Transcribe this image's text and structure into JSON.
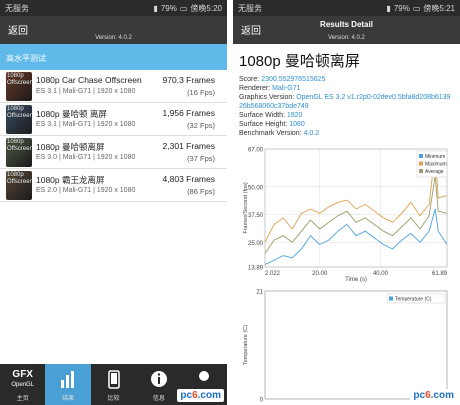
{
  "left": {
    "status": {
      "carrier": "无服务",
      "battery": "79%",
      "time": "傍晚5:20"
    },
    "appbar": {
      "back": "返回",
      "version": "Version: 4.0.2"
    },
    "section": "高水平测试",
    "tests": [
      {
        "thumb": "1080p Offscreen",
        "name": "1080p Car Chase Offscreen",
        "sub": "ES 3.1 | Mali-G71 | 1920 x 1080",
        "frames": "970.3 Frames",
        "fps": "(16 Fps)",
        "color": "#6b3b2a"
      },
      {
        "thumb": "1080p Offscreen",
        "name": "1080p 曼哈顿 离屏",
        "sub": "ES 3.1 | Mali-G71 | 1920 x 1080",
        "frames": "1,956 Frames",
        "fps": "(32 Fps)",
        "color": "#3a4f66"
      },
      {
        "thumb": "1080p Offscreen",
        "name": "1080p 曼哈顿离屏",
        "sub": "ES 3.0 | Mali-G71 | 1920 x 1080",
        "frames": "2,301 Frames",
        "fps": "(37 Fps)",
        "color": "#4d5a44"
      },
      {
        "thumb": "1080p Offscreen",
        "name": "1080p 霸王龙离屏",
        "sub": "ES 2.0 | Mali-G71 | 1920 x 1080",
        "frames": "4,803 Frames",
        "fps": "(86 Fps)",
        "color": "#5b4a3a"
      }
    ],
    "nav": [
      {
        "label": "主页",
        "icon": "gfx-logo"
      },
      {
        "label": "结果",
        "icon": "bar-chart-icon"
      },
      {
        "label": "比较",
        "icon": "phone-icon"
      },
      {
        "label": "信息",
        "icon": "info-icon"
      },
      {
        "label": "设置",
        "icon": "person-icon"
      }
    ],
    "gfx_main": "GFX",
    "gfx_sub": "OpenGL",
    "watermark": "pc6.com"
  },
  "right": {
    "status": {
      "carrier": "无服务",
      "battery": "79%",
      "time": "傍晚5:21"
    },
    "appbar": {
      "back": "返回",
      "title": "Results Detail",
      "version": "Version: 4.0.2"
    },
    "heading": "1080p 曼哈顿离屏",
    "details": [
      {
        "k": "Score: ",
        "v": "2300.552978515625"
      },
      {
        "k": "Renderer: ",
        "v": "Mali-G71"
      },
      {
        "k": "Graphics Version: ",
        "v": "OpenGL ES 3.2 v1.r2p0-02dev0.5bfa8d208b613926b568060c37bde749"
      },
      {
        "k": "Surface Width: ",
        "v": "1920"
      },
      {
        "k": "Surface Height: ",
        "v": "1080"
      },
      {
        "k": "Benchmark Version: ",
        "v": "4.0.2"
      }
    ],
    "watermark": "pc6.com"
  },
  "chart_data": [
    {
      "type": "line",
      "ylabel": "Frames/Second (fps)",
      "xlabel": "Time (s)",
      "xlim": [
        2.022,
        61.89
      ],
      "ylim": [
        13.89,
        67.0
      ],
      "xticks": [
        "2.022",
        "20.00",
        "40.00",
        "61.89"
      ],
      "yticks": [
        "13.89",
        "25.00",
        "37.50",
        "50.00",
        "67.00"
      ],
      "legend": "top-right",
      "x": [
        2.022,
        5,
        8,
        11,
        14,
        17,
        20,
        23,
        26,
        29,
        32,
        35,
        38,
        41,
        44,
        47,
        50,
        53,
        56,
        58,
        59,
        61.89
      ],
      "series": [
        {
          "name": "Minimum",
          "color": "#4aa3df",
          "values": [
            15,
            17,
            19,
            18,
            22,
            28,
            24,
            26,
            30,
            33,
            28,
            30,
            27,
            24,
            22,
            26,
            29,
            25,
            30,
            40,
            30,
            24
          ]
        },
        {
          "name": "Maximum",
          "color": "#e0a050",
          "values": [
            25,
            33,
            36,
            31,
            38,
            40,
            38,
            41,
            43,
            44,
            40,
            42,
            39,
            36,
            34,
            38,
            43,
            37,
            42,
            66,
            45,
            46
          ]
        },
        {
          "name": "Average",
          "color": "#9c9c6a",
          "values": [
            20,
            26,
            28,
            25,
            30,
            35,
            31,
            34,
            37,
            39,
            34,
            36,
            33,
            30,
            28,
            32,
            36,
            31,
            37,
            55,
            39,
            38
          ]
        }
      ]
    },
    {
      "type": "line",
      "ylabel": "Temperature (C)",
      "ylim": [
        0,
        21
      ],
      "yticks": [
        "21",
        "0"
      ],
      "legend": "top-right",
      "series": [
        {
          "name": "Temperature (C)",
          "color": "#4aa3df",
          "values": []
        }
      ]
    }
  ]
}
